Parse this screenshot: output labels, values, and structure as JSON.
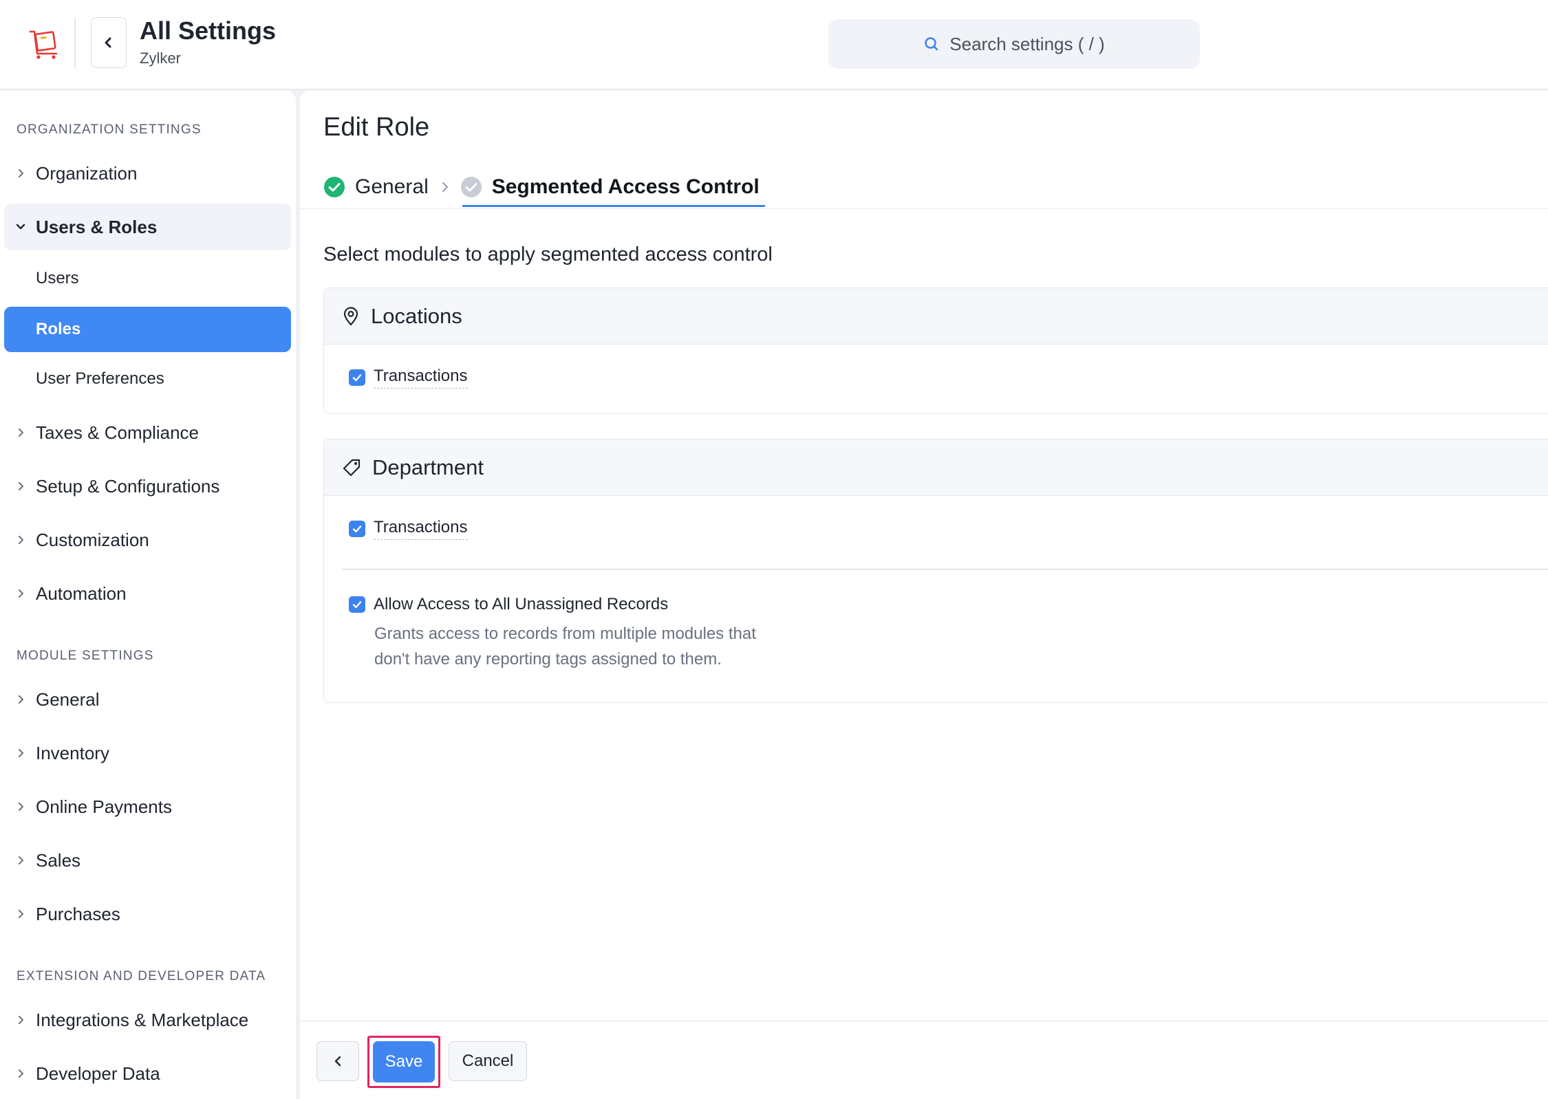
{
  "header": {
    "title": "All Settings",
    "org_name": "Zylker",
    "search_placeholder": "Search settings ( / )"
  },
  "sidebar": {
    "org_section_title": "ORGANIZATION SETTINGS",
    "org_items": [
      {
        "label": "Organization",
        "state": "collapsed"
      },
      {
        "label": "Users & Roles",
        "state": "expanded"
      }
    ],
    "users_roles_children": [
      {
        "label": "Users",
        "active": false
      },
      {
        "label": "Roles",
        "active": true
      },
      {
        "label": "User Preferences",
        "active": false
      }
    ],
    "org_items_rest": [
      {
        "label": "Taxes & Compliance"
      },
      {
        "label": "Setup & Configurations"
      },
      {
        "label": "Customization"
      },
      {
        "label": "Automation"
      }
    ],
    "module_section_title": "MODULE SETTINGS",
    "module_items": [
      {
        "label": "General"
      },
      {
        "label": "Inventory"
      },
      {
        "label": "Online Payments"
      },
      {
        "label": "Sales"
      },
      {
        "label": "Purchases"
      }
    ],
    "extension_section_title": "EXTENSION AND DEVELOPER DATA",
    "extension_items": [
      {
        "label": "Integrations & Marketplace"
      },
      {
        "label": "Developer Data"
      }
    ]
  },
  "main": {
    "page_title": "Edit Role",
    "steps": [
      {
        "label": "General",
        "status": "complete"
      },
      {
        "label": "Segmented Access Control",
        "status": "current"
      }
    ],
    "intro": "Select modules to apply segmented access control",
    "locations": {
      "title": "Locations",
      "transactions_label": "Transactions",
      "transactions_checked": true
    },
    "department": {
      "title": "Department",
      "transactions_label": "Transactions",
      "transactions_checked": true,
      "unassigned_label": "Allow Access to All Unassigned Records",
      "unassigned_checked": true,
      "unassigned_desc_line1": "Grants access to records from multiple modules that",
      "unassigned_desc_line2": "don't have any reporting tags assigned to them."
    }
  },
  "footer": {
    "save_label": "Save",
    "cancel_label": "Cancel"
  },
  "colors": {
    "accent": "#4088f4",
    "success": "#1fb572",
    "highlight": "#e0245e"
  }
}
